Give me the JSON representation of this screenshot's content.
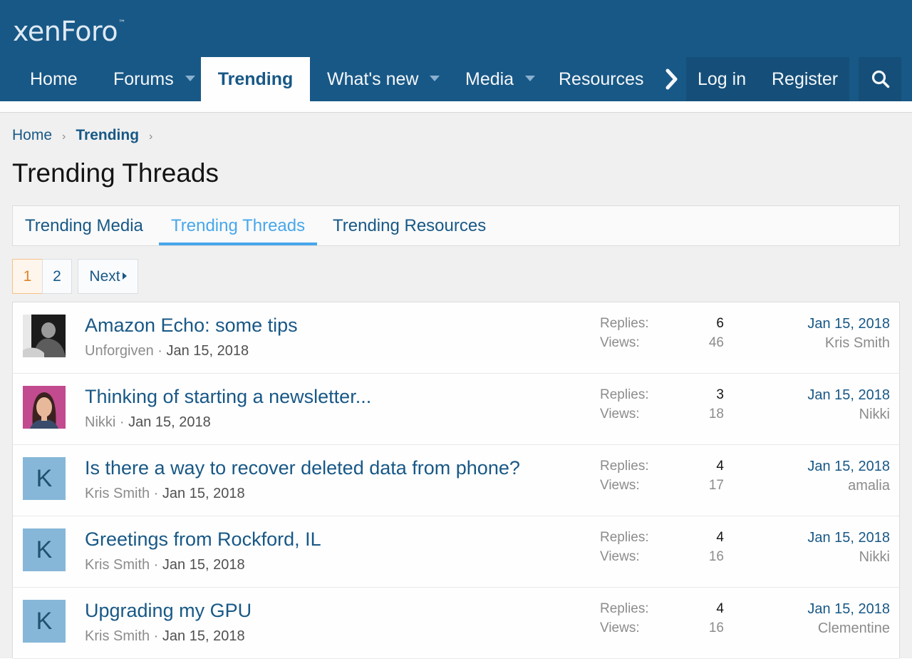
{
  "header": {
    "logo_text": "xenForo",
    "logo_mark": "™",
    "brand_color": "#185886"
  },
  "nav": {
    "home": "Home",
    "forums": "Forums",
    "trending": "Trending",
    "whats_new": "What's new",
    "media": "Media",
    "resources": "Resources",
    "login": "Log in",
    "register": "Register"
  },
  "breadcrumb": {
    "home": "Home",
    "current": "Trending"
  },
  "page_title": "Trending Threads",
  "tabs": [
    {
      "label": "Trending Media"
    },
    {
      "label": "Trending Threads",
      "active": true
    },
    {
      "label": "Trending Resources"
    }
  ],
  "pagination": {
    "pages": [
      "1",
      "2"
    ],
    "current": "1",
    "next_label": "Next"
  },
  "stat_labels": {
    "replies": "Replies:",
    "views": "Views:"
  },
  "threads": [
    {
      "title": "Amazon Echo: some tips",
      "author": "Unforgiven",
      "date": "Jan 15, 2018",
      "replies": "6",
      "views": "46",
      "last_date": "Jan 15, 2018",
      "last_user": "Kris Smith",
      "avatar": "photo-dark"
    },
    {
      "title": "Thinking of starting a newsletter...",
      "author": "Nikki",
      "date": "Jan 15, 2018",
      "replies": "3",
      "views": "18",
      "last_date": "Jan 15, 2018",
      "last_user": "Nikki",
      "avatar": "illustration-woman"
    },
    {
      "title": "Is there a way to recover deleted data from phone?",
      "author": "Kris Smith",
      "date": "Jan 15, 2018",
      "replies": "4",
      "views": "17",
      "last_date": "Jan 15, 2018",
      "last_user": "amalia",
      "avatar": "K"
    },
    {
      "title": "Greetings from Rockford, IL",
      "author": "Kris Smith",
      "date": "Jan 15, 2018",
      "replies": "4",
      "views": "16",
      "last_date": "Jan 15, 2018",
      "last_user": "Nikki",
      "avatar": "K"
    },
    {
      "title": "Upgrading my GPU",
      "author": "Kris Smith",
      "date": "Jan 15, 2018",
      "replies": "4",
      "views": "16",
      "last_date": "Jan 15, 2018",
      "last_user": "Clementine",
      "avatar": "K"
    }
  ]
}
